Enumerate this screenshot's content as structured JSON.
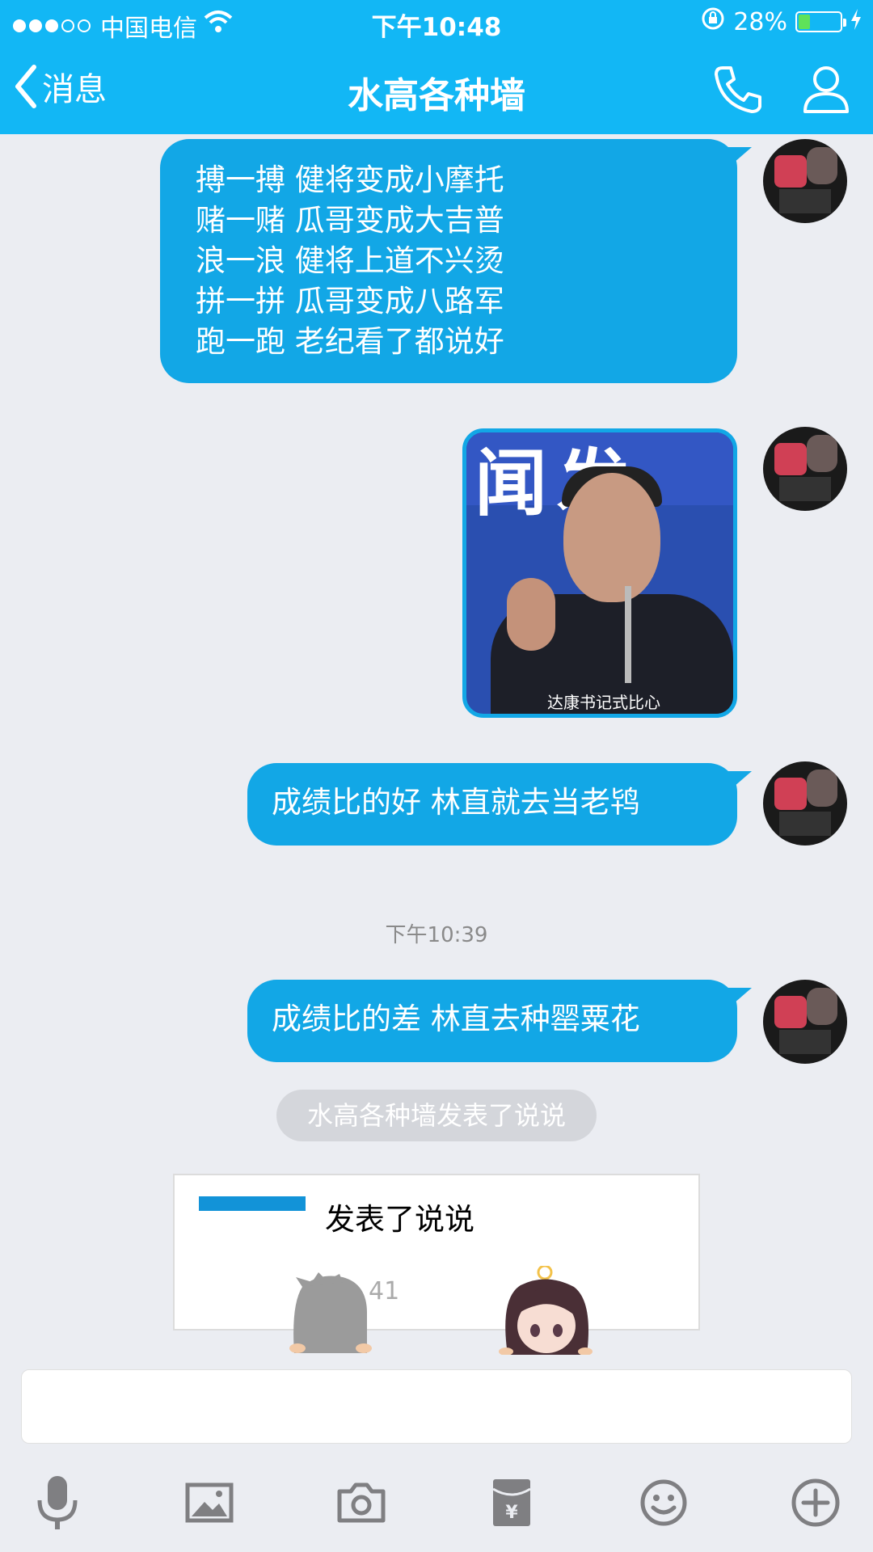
{
  "status_bar": {
    "carrier": "中国电信",
    "time": "下午10:48",
    "battery_percent": "28%",
    "battery_level": 0.28
  },
  "nav": {
    "back_label": "消息",
    "title": "水高各种墙"
  },
  "messages": [
    {
      "lines": [
        "搏一搏 健将变成小摩托",
        "赌一赌 瓜哥变成大吉普",
        "浪一浪 健将上道不兴烫",
        "拼一拼 瓜哥变成八路军",
        "跑一跑 老纪看了都说好"
      ]
    },
    {
      "image_caption": "达康书记式比心",
      "image_banner_text": "闻发"
    },
    {
      "text": "成绩比的好 林直就去当老鸨"
    },
    {
      "text": "成绩比的差 林直去种罂粟花"
    }
  ],
  "timestamp": "下午10:39",
  "system_note": "水高各种墙发表了说说",
  "shuoshuo_card": {
    "title": "发表了说说",
    "count": "41"
  },
  "colors": {
    "accent": "#12b7f5",
    "bubble": "#12a7e6",
    "background": "#ebedf2"
  },
  "toolbar_icons": [
    "microphone-icon",
    "image-icon",
    "camera-icon",
    "red-packet-icon",
    "emoji-icon",
    "plus-icon"
  ]
}
